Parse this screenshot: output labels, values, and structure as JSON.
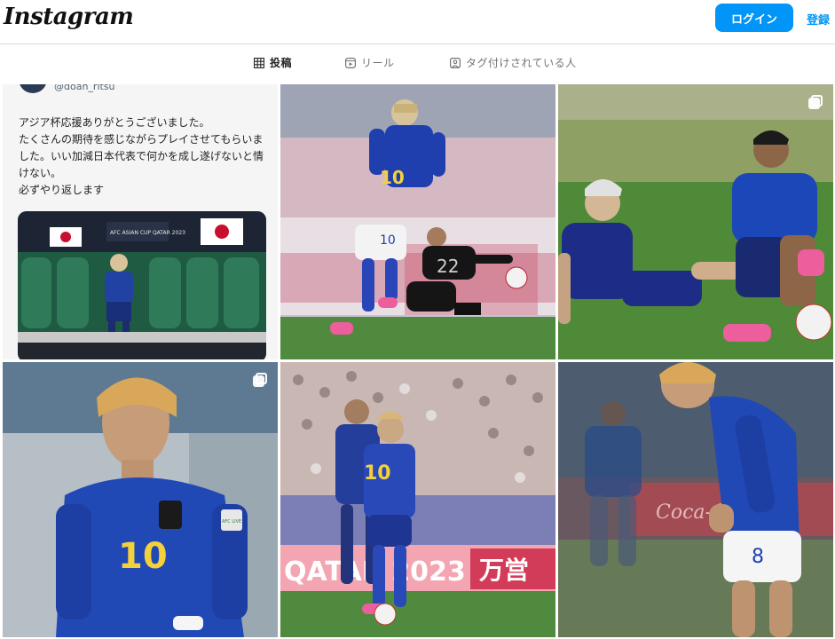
{
  "header": {
    "logo": "Instagram",
    "login_label": "ログイン",
    "signup_label": "登録"
  },
  "tabs": [
    {
      "label": "投稿",
      "icon": "grid-icon",
      "active": true
    },
    {
      "label": "リール",
      "icon": "reels-icon",
      "active": false
    },
    {
      "label": "タグ付けされている人",
      "icon": "tagged-icon",
      "active": false
    }
  ],
  "posts": {
    "tweet": {
      "handle": "@doan_ritsu",
      "lines": [
        "アジア杯応援ありがとうございました。",
        "たくさんの期待を感じながらプレイさせてもらいま",
        "した。いい加減日本代表で何かを成し遂げないと情",
        "けない。",
        "必ずやり返します"
      ],
      "banner_text": "AFC ASIAN CUP QATAR 2023"
    },
    "p2": {
      "shirt_numbers": [
        "10",
        "10",
        "22"
      ]
    },
    "p4": {
      "shirt_number": "10",
      "badge": "AFC LIVE"
    },
    "p5": {
      "shirt_number": "10",
      "board_text_1": "QATAR 2023",
      "board_text_2": "万営"
    },
    "p6": {
      "shirt_number": "8",
      "board_text": "Coca-Cola"
    }
  },
  "colors": {
    "accent": "#0095f6",
    "japan_blue": "#1f3a8a",
    "pitch_green": "#3f7d3a"
  }
}
